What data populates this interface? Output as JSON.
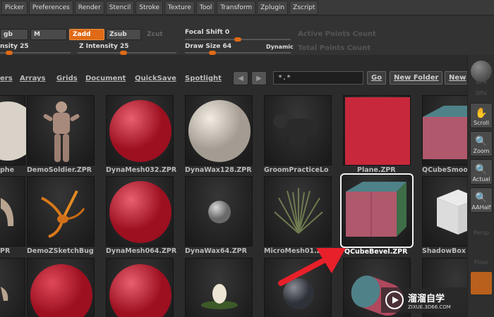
{
  "menubar": {
    "items": [
      "Picker",
      "Preferences",
      "Render",
      "Stencil",
      "Stroke",
      "Texture",
      "Tool",
      "Transform",
      "Zplugin",
      "Zscript"
    ]
  },
  "controls": {
    "rgb": "gb",
    "m": "M",
    "zadd": "Zadd",
    "zsub": "Zsub",
    "zcut": "Zcut",
    "rgb_intensity": "nsity 25",
    "z_intensity": "Z Intensity 25",
    "focal_shift": "Focal Shift 0",
    "draw_size": "Draw Size 64",
    "dynamic": "Dynamic",
    "active_points": "Active Points Count",
    "total_points": "Total Points Count"
  },
  "lightbox": {
    "tabs": [
      "ers",
      "Arrays",
      "Grids",
      "Document",
      "QuickSave",
      "Spotlight"
    ],
    "filter": "*.*",
    "go": "Go",
    "new_folder": "New Folder",
    "new": "New"
  },
  "thumbnails": [
    {
      "caption": "phe",
      "kind": "partial-sphere-white"
    },
    {
      "caption": "DemoSoldier.ZPR",
      "kind": "soldier"
    },
    {
      "caption": "DynaMesh032.ZPR",
      "kind": "red-sphere"
    },
    {
      "caption": "DynaWax128.ZPR",
      "kind": "white-sphere"
    },
    {
      "caption": "GroomPracticeLo",
      "kind": "dog"
    },
    {
      "caption": "Plane.ZPR",
      "kind": "red-plane"
    },
    {
      "caption": "QCubeSmoo",
      "kind": "cube"
    },
    {
      "caption": "PR",
      "kind": "partial-creature"
    },
    {
      "caption": "DemoZSketchBug",
      "kind": "bug"
    },
    {
      "caption": "DynaMesh064.ZPR",
      "kind": "red-sphere"
    },
    {
      "caption": "DynaWax64.ZPR",
      "kind": "small-grey-sphere"
    },
    {
      "caption": "MicroMesh01.ZPR",
      "kind": "plant"
    },
    {
      "caption": "QCubeBevel.ZPR",
      "kind": "cube-selected"
    },
    {
      "caption": "ShadowBox",
      "kind": "shadowbox"
    },
    {
      "caption": "",
      "kind": "partial-creature2"
    },
    {
      "caption": "",
      "kind": "red-sphere-low"
    },
    {
      "caption": "",
      "kind": "red-sphere"
    },
    {
      "caption": "",
      "kind": "egg"
    },
    {
      "caption": "",
      "kind": "textured-sphere"
    },
    {
      "caption": "",
      "kind": "capsule"
    },
    {
      "caption": "",
      "kind": "blank"
    }
  ],
  "shelf": {
    "bpr": "BPR",
    "spix": "SPix",
    "scroll": "Scroll",
    "zoom": "Zoom",
    "actual": "Actual",
    "aahalf": "AAHalf",
    "persp": "Persp",
    "floor": "Floor"
  },
  "watermark": {
    "title": "溜溜自学",
    "url": "ZIXUE.3D66.COM"
  },
  "colors": {
    "accent": "#e06a16",
    "annotation_arrow": "#e8202a"
  }
}
